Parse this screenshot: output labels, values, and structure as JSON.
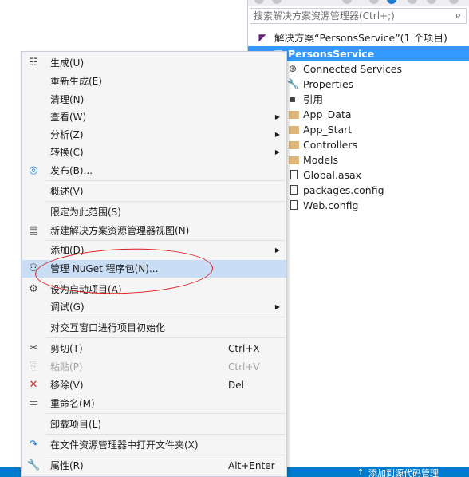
{
  "solution_explorer": {
    "search_placeholder": "搜索解决方案资源管理器(Ctrl+;)",
    "items": [
      {
        "label": "解决方案“PersonsService”(1 个项目)",
        "icon": "solution-icon"
      },
      {
        "label": "PersonsService",
        "icon": "project-icon",
        "selected": true
      },
      {
        "label": "Connected Services",
        "icon": "connected-services-icon"
      },
      {
        "label": "Properties",
        "icon": "wrench-icon"
      },
      {
        "label": "引用",
        "icon": "references-icon"
      },
      {
        "label": "App_Data",
        "icon": "folder-icon"
      },
      {
        "label": "App_Start",
        "icon": "folder-icon"
      },
      {
        "label": "Controllers",
        "icon": "folder-icon"
      },
      {
        "label": "Models",
        "icon": "folder-icon"
      },
      {
        "label": "Global.asax",
        "icon": "file-icon"
      },
      {
        "label": "packages.config",
        "icon": "file-icon"
      },
      {
        "label": "Web.config",
        "icon": "file-icon"
      }
    ]
  },
  "context_menu": {
    "items": [
      {
        "label": "生成(U)",
        "icon": "build-icon"
      },
      {
        "label": "重新生成(E)"
      },
      {
        "label": "清理(N)"
      },
      {
        "label": "查看(W)",
        "submenu": true
      },
      {
        "label": "分析(Z)",
        "submenu": true
      },
      {
        "label": "转换(C)",
        "submenu": true
      },
      {
        "label": "发布(B)...",
        "icon": "globe-icon"
      },
      {
        "label": "概述(V)"
      },
      {
        "label": "限定为此范围(S)"
      },
      {
        "label": "新建解决方案资源管理器视图(N)",
        "icon": "new-view-icon"
      },
      {
        "label": "添加(D)",
        "submenu": true
      },
      {
        "label": "管理 NuGet 程序包(N)...",
        "icon": "nuget-icon",
        "highlighted": true
      },
      {
        "label": "设为启动项目(A)",
        "icon": "gear-icon"
      },
      {
        "label": "调试(G)",
        "submenu": true
      },
      {
        "label": "对交互窗口进行项目初始化"
      },
      {
        "label": "剪切(T)",
        "icon": "scissors-icon",
        "shortcut": "Ctrl+X"
      },
      {
        "label": "粘贴(P)",
        "icon": "paste-icon",
        "shortcut": "Ctrl+V",
        "disabled": true
      },
      {
        "label": "移除(V)",
        "icon": "remove-icon",
        "shortcut": "Del"
      },
      {
        "label": "重命名(M)",
        "icon": "rename-icon"
      },
      {
        "label": "卸载项目(L)"
      },
      {
        "label": "在文件资源管理器中打开文件夹(X)",
        "icon": "open-folder-icon"
      },
      {
        "label": "属性(R)",
        "icon": "wrench-icon",
        "shortcut": "Alt+Enter"
      }
    ]
  },
  "status_bar": {
    "source_control_label": "添加到源代码管理"
  },
  "colors": {
    "accent": "#007acc",
    "selection": "#3399ff",
    "menu_highlight": "#c9def5",
    "annotation": "#e02020"
  }
}
